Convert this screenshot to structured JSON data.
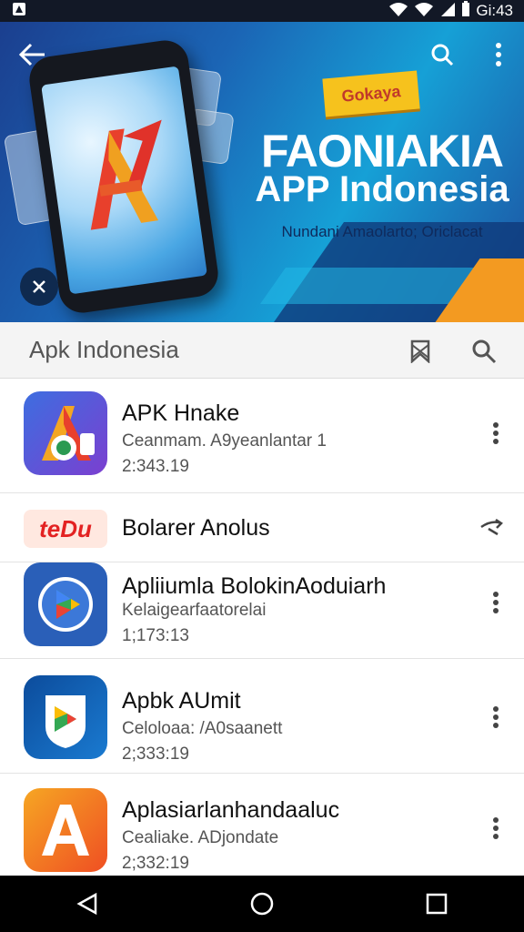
{
  "status_bar": {
    "time": "Gi:43",
    "icons": [
      "notification-icon",
      "wifi-icon",
      "signal-icon",
      "battery-icon"
    ]
  },
  "banner": {
    "promo_tag": "Gokaya",
    "title_line1": "FAONIAKIA",
    "title_line2": "APP Indonesia",
    "subtitle": "Nundani Amaolarto; Oriclacat",
    "colors": {
      "primary": "#1b65b5",
      "accent": "#f39a21",
      "promo": "#f6c21d"
    }
  },
  "search": {
    "query": "Apk Indonesia"
  },
  "list": [
    {
      "name": "APK Hnake",
      "subtitle": "Ceanmam. A9yeanlantar 1",
      "date": "2:343.19"
    },
    {
      "promo": true,
      "badge": "teDu",
      "name": "Bolarer Anolus"
    },
    {
      "name": "Apliiumla BolokinAoduiarh",
      "subtitle": "Kelaigearfaatorelai",
      "date": "1;173:13"
    },
    {
      "name": "Apbk AUmit",
      "subtitle": "Celoloaa: /A0saanett",
      "date": "2;333:19"
    },
    {
      "name": "Aplasiarlanhandaaluc",
      "subtitle": "Cealiake. ADjondate",
      "date": "2;332:19"
    }
  ]
}
